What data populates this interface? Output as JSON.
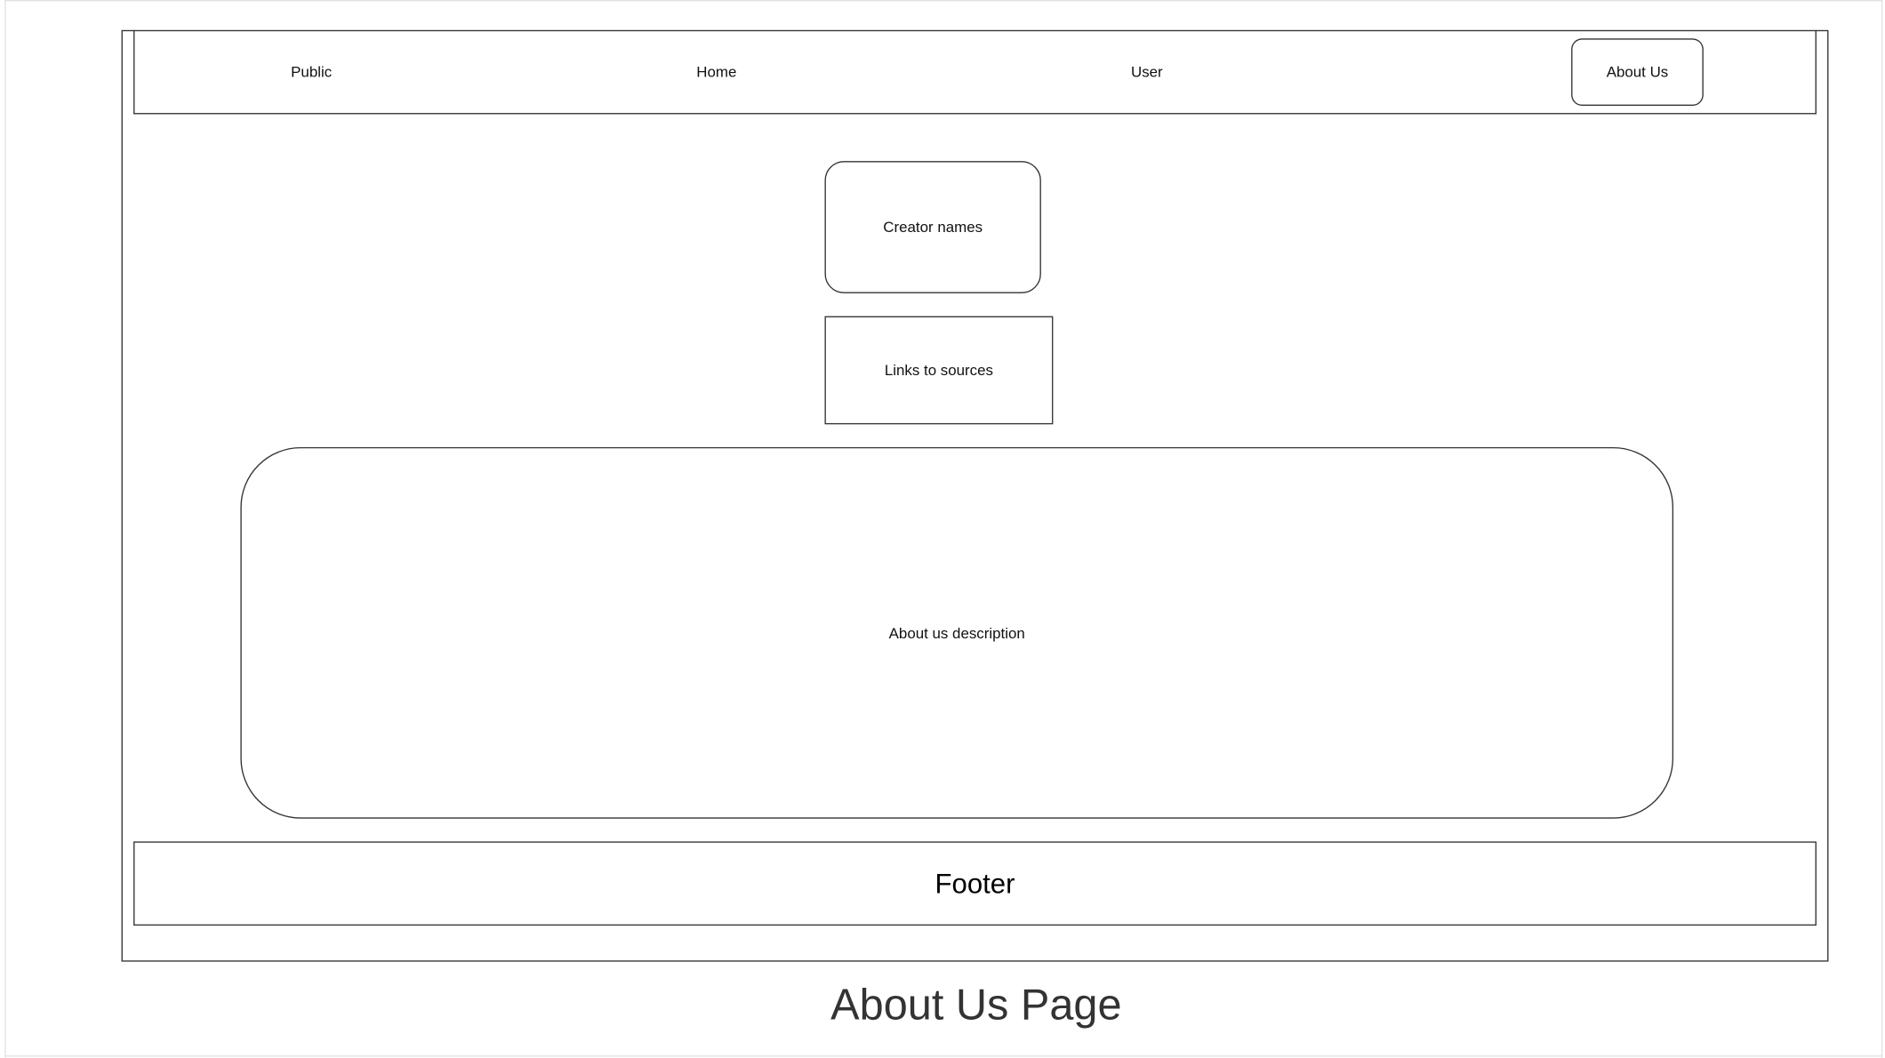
{
  "nav": {
    "public_label": "Public",
    "home_label": "Home",
    "user_label": "User",
    "about_label": "About Us"
  },
  "content": {
    "creator_names": "Creator names",
    "links_to_sources": "Links to sources",
    "about_description": "About us description"
  },
  "footer": {
    "label": "Footer"
  },
  "caption": {
    "title": "About Us Page"
  }
}
